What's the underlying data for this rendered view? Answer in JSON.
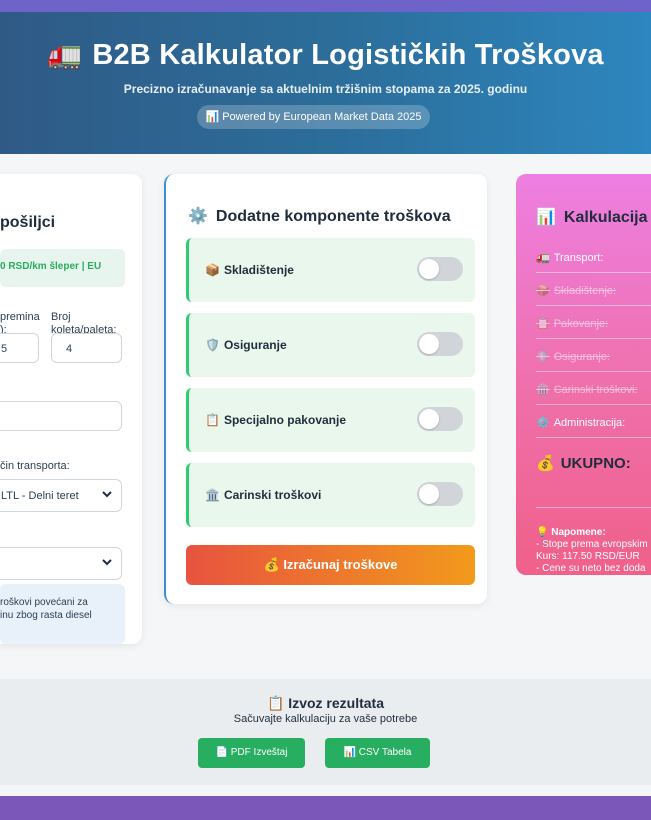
{
  "header": {
    "truck_icon": "🚛",
    "title": "B2B Kalkulator Logističkih Troškova",
    "subtitle": "Precizno izračunavanje sa aktuelnim tržišnim stopama za 2025. godinu",
    "badge": "📊 Powered by European Market Data 2025"
  },
  "left_panel": {
    "title": "pošiljci",
    "rate_text": "0 RSD/km šleper | EU",
    "label_weight": "premina",
    "label_weight2": "):",
    "weight_value": "5",
    "label_packages": "Broj",
    "label_packages2": "koleta/paleta:",
    "packages_value": "4",
    "distance_value": "",
    "label_transport": "čin transporta:",
    "transport_value": "LTL - Delni teret",
    "second_select_value": "",
    "note_line1": "roškovi povećani za",
    "note_line2": "inu zbog rasta diesel"
  },
  "components": {
    "title_icon": "⚙️",
    "title": "Dodatne komponente troškova",
    "items": [
      {
        "icon": "📦",
        "label": "Skladištenje",
        "enabled": false
      },
      {
        "icon": "🛡️",
        "label": "Osiguranje",
        "enabled": false
      },
      {
        "icon": "📋",
        "label": "Specijalno pakovanje",
        "enabled": false
      },
      {
        "icon": "🏛️",
        "label": "Carinski troškovi",
        "enabled": false
      }
    ],
    "calc_button": "💰 Izračunaj troškove"
  },
  "calculation": {
    "title_icon": "📊",
    "title": "Kalkulacija",
    "rows": [
      {
        "icon": "🚛",
        "label": "Transport:",
        "active": true
      },
      {
        "icon": "📦",
        "label": "Skladištenje:",
        "active": false
      },
      {
        "icon": "📋",
        "label": "Pakovanje:",
        "active": false
      },
      {
        "icon": "🛡️",
        "label": "Osiguranje:",
        "active": false
      },
      {
        "icon": "🏛️",
        "label": "Carinski troškovi:",
        "active": false
      },
      {
        "icon": "⚙️",
        "label": "Administracija:",
        "active": true
      }
    ],
    "total_icon": "💰",
    "total_label": "UKUPNO:",
    "notes_title": "💡 Napomene:",
    "notes_line1": "- Stope prema evropskim",
    "notes_line2": "Kurs: 117.50 RSD/EUR",
    "notes_line3": "- Cene su neto bez doda"
  },
  "export": {
    "title": "📋 Izvoz rezultata",
    "subtitle": "Sačuvajte kalkulaciju za vaše potrebe",
    "pdf_button": "📄 PDF Izveštaj",
    "csv_button": "📊 CSV Tabela"
  },
  "colors": {
    "accent_blue": "#3d8fd1",
    "green": "#27ae60",
    "orange_start": "#e8533f",
    "orange_end": "#f29a1c",
    "pink_start": "#ee7fe2",
    "pink_end": "#f0608a"
  }
}
